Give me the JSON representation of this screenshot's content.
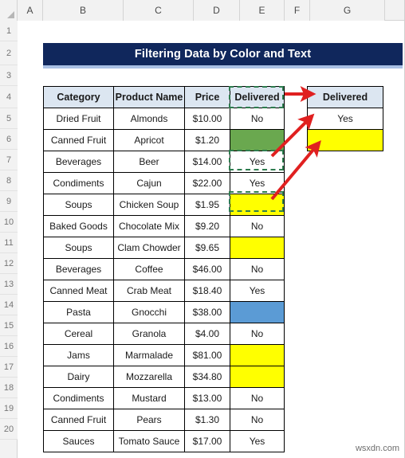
{
  "spreadsheet": {
    "column_headers": [
      "A",
      "B",
      "C",
      "D",
      "E",
      "F",
      "G"
    ],
    "row_numbers": [
      "1",
      "2",
      "3",
      "4",
      "5",
      "6",
      "7",
      "8",
      "9",
      "10",
      "11",
      "12",
      "13",
      "14",
      "15",
      "16",
      "17",
      "18",
      "19",
      "20"
    ]
  },
  "title": {
    "text": "Filtering Data by Color and Text",
    "background_color": "#10275C",
    "underline_color": "#A9C0E4",
    "text_color": "#FFFFFF"
  },
  "table": {
    "headers": [
      "Category",
      "Product Name",
      "Price",
      "Delivered"
    ],
    "header_background": "#DCE6F1",
    "rows": [
      {
        "category": "Dried Fruit",
        "product": "Almonds",
        "price": "$10.00",
        "delivered": "No",
        "fill": "none"
      },
      {
        "category": "Canned Fruit",
        "product": "Apricot",
        "price": "$1.20",
        "delivered": "",
        "fill": "green"
      },
      {
        "category": "Beverages",
        "product": "Beer",
        "price": "$14.00",
        "delivered": "Yes",
        "fill": "none"
      },
      {
        "category": "Condiments",
        "product": "Cajun",
        "price": "$22.00",
        "delivered": "Yes",
        "fill": "none"
      },
      {
        "category": "Soups",
        "product": "Chicken Soup",
        "price": "$1.95",
        "delivered": "",
        "fill": "yellow"
      },
      {
        "category": "Baked Goods",
        "product": "Chocolate Mix",
        "price": "$9.20",
        "delivered": "No",
        "fill": "none"
      },
      {
        "category": "Soups",
        "product": "Clam Chowder",
        "price": "$9.65",
        "delivered": "",
        "fill": "yellow"
      },
      {
        "category": "Beverages",
        "product": "Coffee",
        "price": "$46.00",
        "delivered": "No",
        "fill": "none"
      },
      {
        "category": "Canned Meat",
        "product": "Crab Meat",
        "price": "$18.40",
        "delivered": "Yes",
        "fill": "none"
      },
      {
        "category": "Pasta",
        "product": "Gnocchi",
        "price": "$38.00",
        "delivered": "",
        "fill": "blue"
      },
      {
        "category": "Cereal",
        "product": "Granola",
        "price": "$4.00",
        "delivered": "No",
        "fill": "none"
      },
      {
        "category": "Jams",
        "product": "Marmalade",
        "price": "$81.00",
        "delivered": "",
        "fill": "yellow"
      },
      {
        "category": "Dairy",
        "product": "Mozzarella",
        "price": "$34.80",
        "delivered": "",
        "fill": "yellow"
      },
      {
        "category": "Condiments",
        "product": "Mustard",
        "price": "$13.00",
        "delivered": "No",
        "fill": "none"
      },
      {
        "category": "Canned Fruit",
        "product": "Pears",
        "price": "$1.30",
        "delivered": "No",
        "fill": "none"
      },
      {
        "category": "Sauces",
        "product": "Tomato Sauce",
        "price": "$17.00",
        "delivered": "Yes",
        "fill": "none"
      }
    ],
    "fill_colors": {
      "green": "#6AA84F",
      "yellow": "#FFFF00",
      "blue": "#5B9BD5"
    }
  },
  "result_table": {
    "header": "Delivered",
    "rows": [
      {
        "value": "Yes",
        "fill": "none"
      },
      {
        "value": "",
        "fill": "yellow"
      }
    ]
  },
  "selection": {
    "style": "marching-ants-dashed",
    "color": "#2E7D4F",
    "selected_cells": [
      "E4",
      "E7",
      "E9"
    ]
  },
  "annotations": {
    "arrow_color": "#E02020",
    "arrow_count": 3
  },
  "watermark": {
    "text": "wsxdn.com"
  }
}
